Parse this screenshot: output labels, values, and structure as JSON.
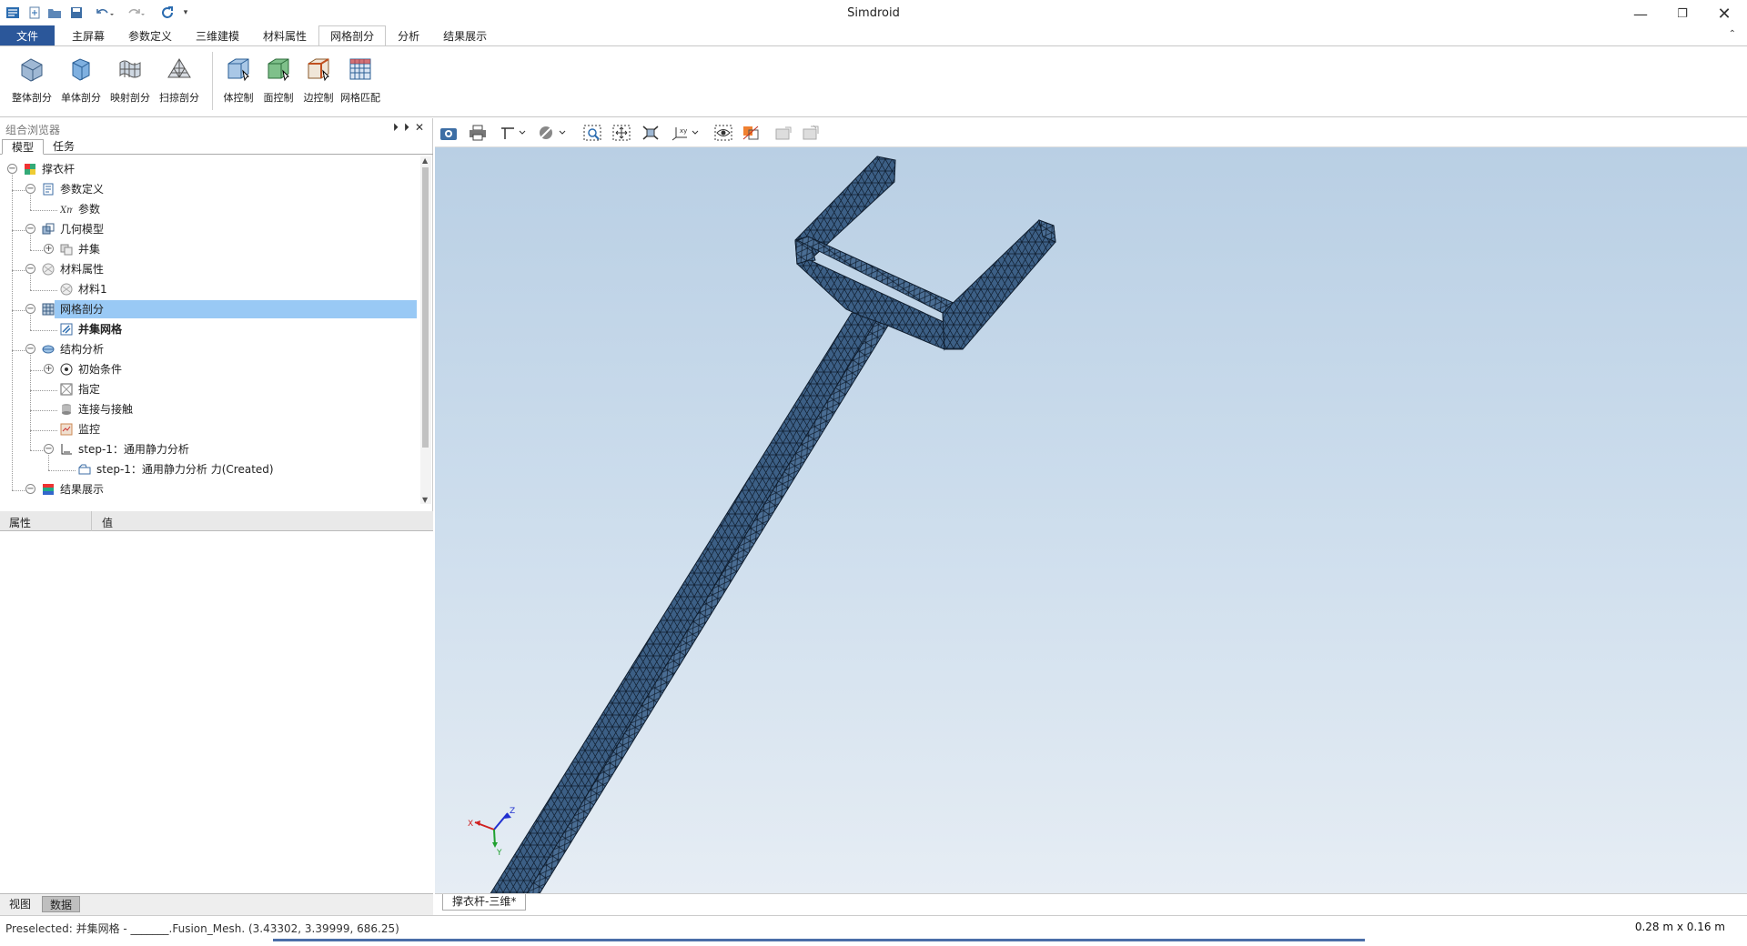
{
  "app": {
    "title": "Simdroid"
  },
  "quick_access": [
    "new-icon",
    "open-icon",
    "save-icon",
    "undo-icon",
    "redo-icon",
    "refresh-icon",
    "customize-icon"
  ],
  "ribbon": {
    "tabs": [
      {
        "label": "文件",
        "active": false
      },
      {
        "label": "主屏幕",
        "active": false
      },
      {
        "label": "参数定义",
        "active": false
      },
      {
        "label": "三维建模",
        "active": false
      },
      {
        "label": "材料属性",
        "active": false
      },
      {
        "label": "网格剖分",
        "active": true
      },
      {
        "label": "分析",
        "active": false
      },
      {
        "label": "结果展示",
        "active": false
      }
    ],
    "buttons": [
      {
        "label": "整体剖分",
        "icon": "mesh-whole-icon"
      },
      {
        "label": "单体剖分",
        "icon": "mesh-single-icon"
      },
      {
        "label": "映射剖分",
        "icon": "mesh-mapped-icon"
      },
      {
        "label": "扫掠剖分",
        "icon": "mesh-sweep-icon"
      },
      {
        "label": "体控制",
        "icon": "body-control-icon"
      },
      {
        "label": "面控制",
        "icon": "face-control-icon"
      },
      {
        "label": "边控制",
        "icon": "edge-control-icon"
      },
      {
        "label": "网格匹配",
        "icon": "mesh-match-icon"
      }
    ]
  },
  "browser": {
    "title": "组合浏览器",
    "tabs": [
      {
        "label": "模型",
        "active": true
      },
      {
        "label": "任务",
        "active": false
      }
    ],
    "tree": [
      {
        "label": "撑衣杆",
        "level": 0,
        "toggle": "-",
        "icon": "model-icon"
      },
      {
        "label": "参数定义",
        "level": 1,
        "toggle": "-",
        "icon": "param-def-icon"
      },
      {
        "label": "参数",
        "level": 2,
        "toggle": "",
        "icon": "xm-icon"
      },
      {
        "label": "几何模型",
        "level": 1,
        "toggle": "-",
        "icon": "geometry-icon"
      },
      {
        "label": "并集",
        "level": 2,
        "toggle": "+",
        "icon": "union-icon"
      },
      {
        "label": "材料属性",
        "level": 1,
        "toggle": "-",
        "icon": "material-icon"
      },
      {
        "label": "材料1",
        "level": 2,
        "toggle": "",
        "icon": "material-icon"
      },
      {
        "label": "网格剖分",
        "level": 1,
        "toggle": "-",
        "icon": "mesh-icon",
        "selected": true
      },
      {
        "label": "并集网格",
        "level": 2,
        "toggle": "",
        "icon": "mesh-item-icon",
        "bold": true
      },
      {
        "label": "结构分析",
        "level": 1,
        "toggle": "-",
        "icon": "analysis-icon"
      },
      {
        "label": "初始条件",
        "level": 2,
        "toggle": "+",
        "icon": "initial-condition-icon"
      },
      {
        "label": "指定",
        "level": 2,
        "toggle": "",
        "icon": "specify-icon"
      },
      {
        "label": "连接与接触",
        "level": 2,
        "toggle": "",
        "icon": "contact-icon"
      },
      {
        "label": "监控",
        "level": 2,
        "toggle": "",
        "icon": "monitor-icon"
      },
      {
        "label": "step-1：通用静力分析",
        "level": 2,
        "toggle": "-",
        "icon": "step-icon"
      },
      {
        "label": "step-1：通用静力分析 力(Created)",
        "level": 3,
        "toggle": "",
        "icon": "load-icon"
      },
      {
        "label": "结果展示",
        "level": 1,
        "toggle": "-",
        "icon": "results-icon"
      }
    ]
  },
  "properties": {
    "col_property": "属性",
    "col_value": "值"
  },
  "left_bottom_tabs": [
    {
      "label": "视图",
      "active": false
    },
    {
      "label": "数据",
      "active": true
    }
  ],
  "viewport": {
    "tab_label": "撑衣杆-三维*",
    "axes": {
      "x": "X",
      "y": "Y",
      "z": "Z"
    },
    "colors": {
      "mesh_fill": "#3c5f85",
      "mesh_line": "#0f1d2e",
      "bg_top": "#b9cfe4",
      "bg_bottom": "#e6edf4"
    }
  },
  "toolbar3d": [
    "screenshot-icon",
    "print-icon",
    "view-axis-icon",
    "draw-style-icon",
    "zoom-box-icon",
    "fit-all-icon",
    "fit-selection-icon",
    "axis-orientation-icon",
    "visibility-icon",
    "section-icon",
    "measure-icon",
    "clear-measure-icon"
  ],
  "status": {
    "message": "Preselected: 并集网格 - _______.Fusion_Mesh. (3.43302, 3.39999, 686.25)",
    "dimensions": "0.28 m x 0.16 m"
  }
}
